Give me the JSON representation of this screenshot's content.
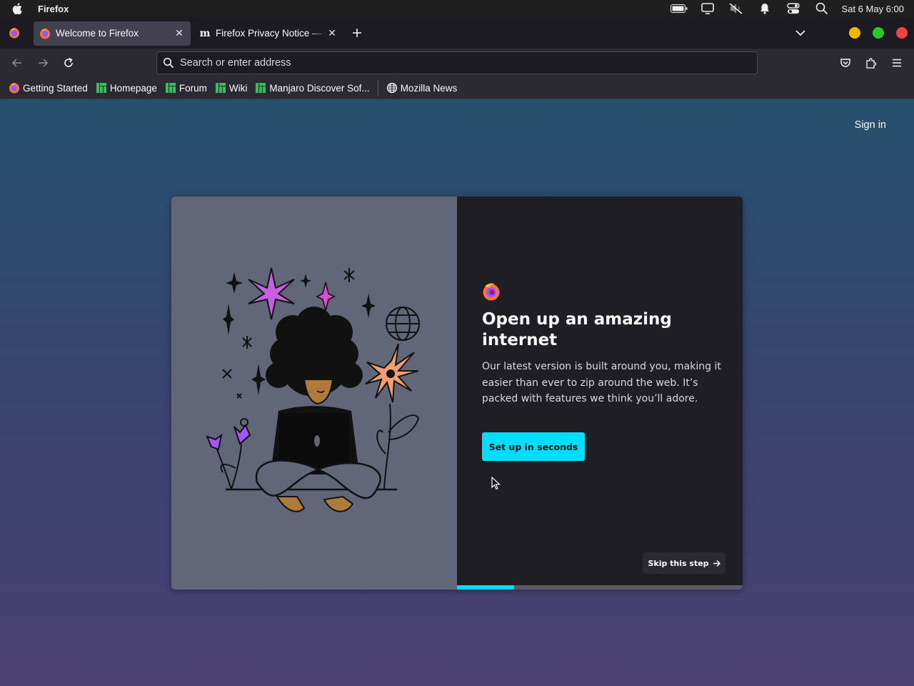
{
  "system_bar": {
    "app_name": "Firefox",
    "clock": "Sat 6 May 6:00",
    "icons": [
      "apple-icon",
      "battery-icon",
      "display-icon",
      "volume-muted-icon",
      "notifications-icon",
      "control-center-icon",
      "search-icon"
    ]
  },
  "tabs": [
    {
      "title": "Welcome to Firefox",
      "active": true,
      "favicon": "firefox-icon"
    },
    {
      "title": "Firefox Privacy Notice — Mozilla",
      "active": false,
      "favicon": "mozilla-m-icon"
    }
  ],
  "window_controls": {
    "colors": [
      "#f5b800",
      "#2dc52d",
      "#ef4444"
    ]
  },
  "urlbar": {
    "placeholder": "Search or enter address"
  },
  "bookmarks": [
    {
      "label": "Getting Started",
      "icon": "firefox-icon"
    },
    {
      "label": "Homepage",
      "icon": "manjaro-icon"
    },
    {
      "label": "Forum",
      "icon": "manjaro-icon"
    },
    {
      "label": "Wiki",
      "icon": "manjaro-icon"
    },
    {
      "label": "Manjaro Discover Sof...",
      "icon": "manjaro-icon"
    },
    {
      "label": "Mozilla News",
      "icon": "globe-icon"
    }
  ],
  "page": {
    "sign_in": "Sign in",
    "heading": "Open up an amazing internet",
    "description": "Our latest version is built around you, making it easier than ever to zip around the web. It’s packed with features we think you’ll adore.",
    "primary_button": "Set up in seconds",
    "skip_button": "Skip this step",
    "progress": 0.2,
    "accent_color": "#00ddff"
  }
}
